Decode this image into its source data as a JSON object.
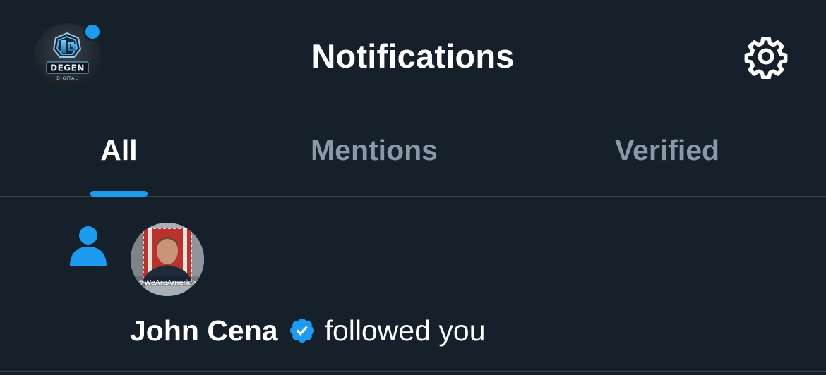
{
  "header": {
    "title": "Notifications",
    "profile_avatar_icon": "degen-digital-logo",
    "settings_icon": "gear-icon",
    "unread_dot_color": "#1d9bf0"
  },
  "tabs": [
    {
      "label": "All",
      "active": true
    },
    {
      "label": "Mentions",
      "active": false
    },
    {
      "label": "Verified",
      "active": false
    }
  ],
  "notifications": [
    {
      "type": "follow",
      "icon": "person-icon",
      "user_name": "John Cena",
      "verified": true,
      "action": "followed you",
      "avatar_caption": "#WeAreAmerica"
    }
  ],
  "colors": {
    "background": "#15202b",
    "accent": "#1d9bf0",
    "inactive_tab": "#8b98a5",
    "divider": "#38444d"
  }
}
